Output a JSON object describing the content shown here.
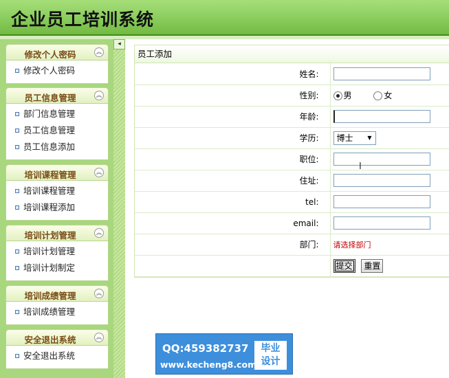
{
  "header": {
    "title": "企业员工培训系统"
  },
  "sidebar": {
    "panels": [
      {
        "title": "修改个人密码",
        "items": [
          "修改个人密码"
        ]
      },
      {
        "title": "员工信息管理",
        "items": [
          "部门信息管理",
          "员工信息管理",
          "员工信息添加"
        ]
      },
      {
        "title": "培训课程管理",
        "items": [
          "培训课程管理",
          "培训课程添加"
        ]
      },
      {
        "title": "培训计划管理",
        "items": [
          "培训计划管理",
          "培训计划制定"
        ]
      },
      {
        "title": "培训成绩管理",
        "items": [
          "培训成绩管理"
        ]
      },
      {
        "title": "安全退出系统",
        "items": [
          "安全退出系统"
        ]
      }
    ],
    "collapse_icon": "chevron-up-double",
    "colors": {
      "panel_title": "#7a4b14",
      "background": "#a8d77e"
    }
  },
  "form": {
    "title": "员工添加",
    "name_label": "姓名:",
    "gender_label": "性别:",
    "gender_options": [
      "男",
      "女"
    ],
    "gender_selected": "男",
    "age_label": "年龄:",
    "education_label": "学历:",
    "education_value": "博士",
    "position_label": "职位:",
    "address_label": "住址:",
    "tel_label": "tel:",
    "email_label": "email:",
    "department_label": "部门:",
    "department_hint": "请选择部门",
    "submit_label": "提交",
    "reset_label": "重置"
  },
  "watermark": {
    "qq": "QQ:459382737",
    "site": "www.kecheng8.com",
    "badge_line1": "毕业",
    "badge_line2": "设计"
  },
  "colors": {
    "header_green": "#8fd062",
    "hint_red": "#c00000",
    "watermark_blue": "#3d8fdc"
  }
}
